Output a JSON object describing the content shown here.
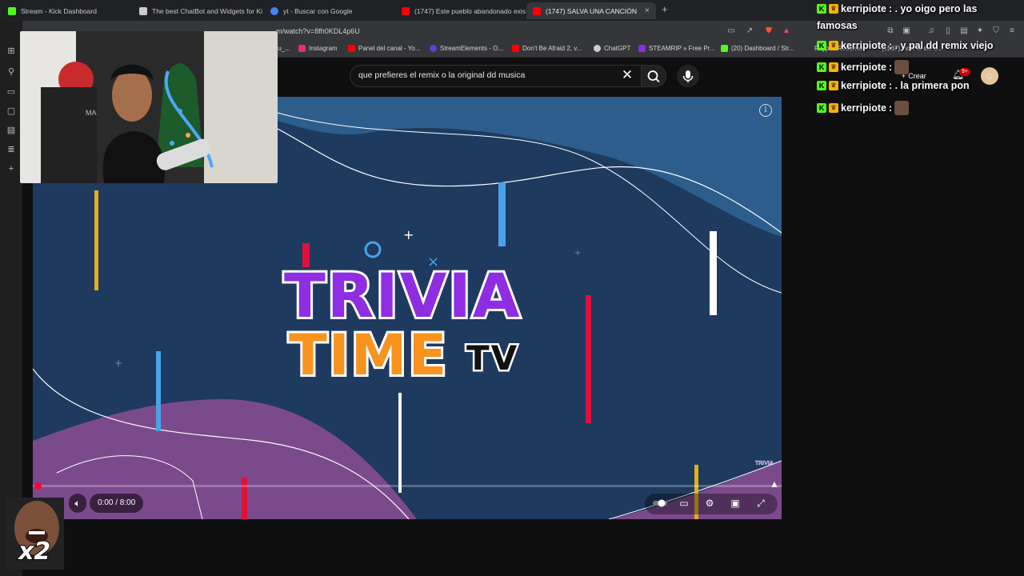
{
  "browser": {
    "tabs": [
      {
        "title": "Stream - Kick Dashboard",
        "favicon_color": "#53fc18",
        "active": false
      },
      {
        "title": "The best ChatBot and Widgets for Ki",
        "favicon_color": "#cccccc",
        "active": false
      },
      {
        "title": "yt - Buscar con Google",
        "favicon_color": "#4285f4",
        "active": false
      },
      {
        "title": "(1747) Este pueblo abandonado exis",
        "favicon_color": "#ff0000",
        "active": false
      },
      {
        "title": "(1747) SALVA UNA CANCIÓN",
        "favicon_color": "#ff0000",
        "active": true
      }
    ],
    "new_tab_icon": "+",
    "tab_close_icon": "×",
    "url": "m/watch?v=8fh0KDL4p6U",
    "bookmarks": [
      {
        "label": "tu_...",
        "color": "#888888"
      },
      {
        "label": "Instagram",
        "color": "#e1306c"
      },
      {
        "label": "Panel del canal - Yo...",
        "color": "#ff0000"
      },
      {
        "label": "StreamElements - O...",
        "color": "#5a3fd8"
      },
      {
        "label": "Don't Be Afraid 2, v...",
        "color": "#ff0000"
      },
      {
        "label": "ChatGPT",
        "color": "#cccccc"
      },
      {
        "label": "STEAMRIP » Free Pr...",
        "color": "#8b2be2"
      },
      {
        "label": "(20) Dashboard / Str...",
        "color": "#53fc18"
      },
      {
        "label": "Paypal: Resumen",
        "color": "#0070ba"
      },
      {
        "label": "(1567) How to ins S...",
        "color": "#ff0000"
      }
    ]
  },
  "youtube": {
    "search_query": "que prefieres el remix o la original dd musica",
    "create_label": "Crear",
    "notification_badge": "9+",
    "player": {
      "logo_line1": "TRIVIA",
      "logo_line2": "TIME",
      "logo_tv": "TV",
      "time": "0:00 / 8:00",
      "watermark": "TRIVIA",
      "progress": 0.0
    }
  },
  "stream_overlay": {
    "webcam_shirt_text": "MA",
    "meme_multiplier": "x2",
    "chat": [
      {
        "user": "kerripiote",
        "message": ": . yo oigo pero las"
      },
      {
        "user": "",
        "message": "famosas"
      },
      {
        "user": "kerripiote",
        "message": ": . y pal dd remix viejo"
      },
      {
        "user": "kerripiote",
        "message": ":"
      },
      {
        "user": "kerripiote",
        "message": ": . la primera pon"
      },
      {
        "user": "kerripiote",
        "message": ":"
      }
    ]
  },
  "colors": {
    "video_bg": "#1e3a5f",
    "kick_green": "#53fc18",
    "yt_red": "#ff0033"
  }
}
